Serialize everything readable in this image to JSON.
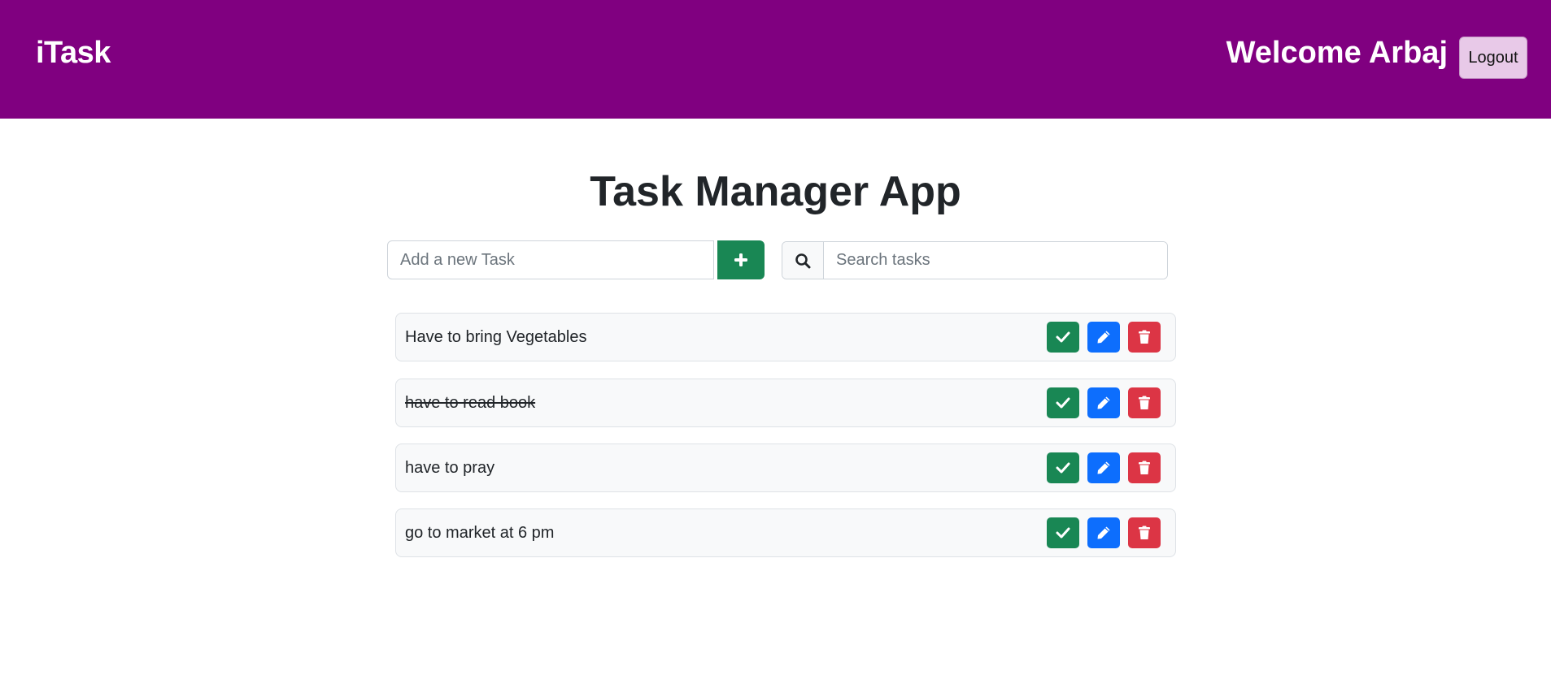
{
  "navbar": {
    "brand": "iTask",
    "welcome": "Welcome Arbaj",
    "logout_label": "Logout",
    "background": "#800080"
  },
  "main": {
    "title": "Task Manager App",
    "add_task": {
      "placeholder": "Add a new Task",
      "value": "",
      "button_icon": "plus-icon"
    },
    "search": {
      "placeholder": "Search tasks",
      "value": "",
      "icon": "search-icon"
    },
    "tasks": [
      {
        "text": "Have to bring Vegetables",
        "completed": false
      },
      {
        "text": "have to read book",
        "completed": true
      },
      {
        "text": "have to pray",
        "completed": false
      },
      {
        "text": "go to market at 6 pm",
        "completed": false
      }
    ],
    "actions": {
      "complete_icon": "check-icon",
      "edit_icon": "pencil-icon",
      "delete_icon": "trash-icon",
      "complete_color": "#198754",
      "edit_color": "#0d6efd",
      "delete_color": "#dc3545"
    }
  }
}
